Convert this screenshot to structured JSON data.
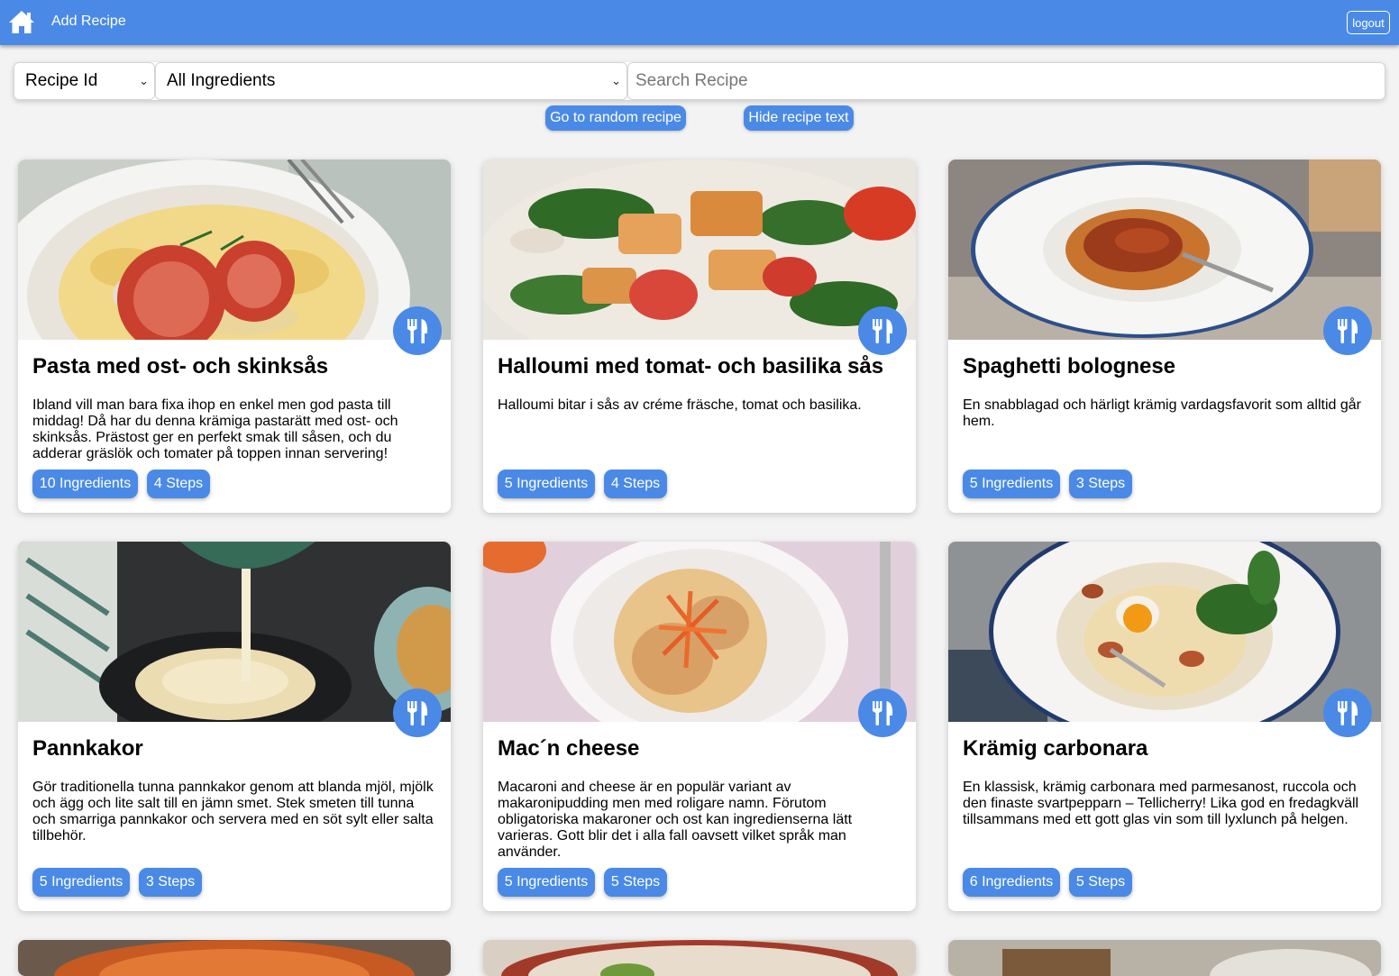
{
  "header": {
    "home_icon": "home-icon",
    "add_recipe_label": "Add Recipe",
    "logout_label": "logout",
    "bar_color": "#4a8ae6"
  },
  "filters": {
    "sort_by": "Recipe Id",
    "ingredients": "All Ingredients",
    "search_placeholder": "Search Recipe",
    "search_value": ""
  },
  "actions": {
    "random_label": "Go to random recipe",
    "hide_text_label": "Hide recipe text"
  },
  "recipes": [
    {
      "title": "Pasta med ost- och skinksås",
      "description": "Ibland vill man bara fixa ihop en enkel men god pasta till middag! Då har du denna krämiga pastarätt med ost- och skinksås. Prästost ger en perfekt smak till såsen, och du adderar gräslök och tomater på toppen innan servering!",
      "ingredients": "10 Ingredients",
      "steps": "4 Steps",
      "photo": "pasta-photo"
    },
    {
      "title": "Halloumi med tomat- och basilika sås",
      "description": "Halloumi bitar i sås av créme fräsche, tomat och basilika.",
      "ingredients": "5 Ingredients",
      "steps": "4 Steps",
      "photo": "halloumi-photo"
    },
    {
      "title": "Spaghetti bolognese",
      "description": "En snabblagad och härligt krämig vardagsfavorit som alltid går hem.",
      "ingredients": "5 Ingredients",
      "steps": "3 Steps",
      "photo": "spaghetti-photo"
    },
    {
      "title": "Pannkakor",
      "description": "Gör traditionella tunna pannkakor genom att blanda mjöl, mjölk och ägg och lite salt till en jämn smet. Stek smeten till tunna och smarriga pannkakor och servera med en söt sylt eller salta tillbehör.",
      "ingredients": "5 Ingredients",
      "steps": "3 Steps",
      "photo": "pancake-photo"
    },
    {
      "title": "Mac´n cheese",
      "description": "Macaroni and cheese är en populär variant av makaronipudding men med roligare namn. Förutom obligatoriska makaroner och ost kan ingredienserna lätt varieras. Gott blir det i alla fall oavsett vilket språk man använder.",
      "ingredients": "5 Ingredients",
      "steps": "5 Steps",
      "photo": "mac-cheese-photo"
    },
    {
      "title": "Krämig carbonara",
      "description": "En klassisk, krämig carbonara med parmesanost, ruccola och den finaste svartpepparn – Tellicherry! Lika god en fredagkväll tillsammans med ett gott glas vin som till lyxlunch på helgen.",
      "ingredients": "6 Ingredients",
      "steps": "5 Steps",
      "photo": "carbonara-photo"
    }
  ]
}
